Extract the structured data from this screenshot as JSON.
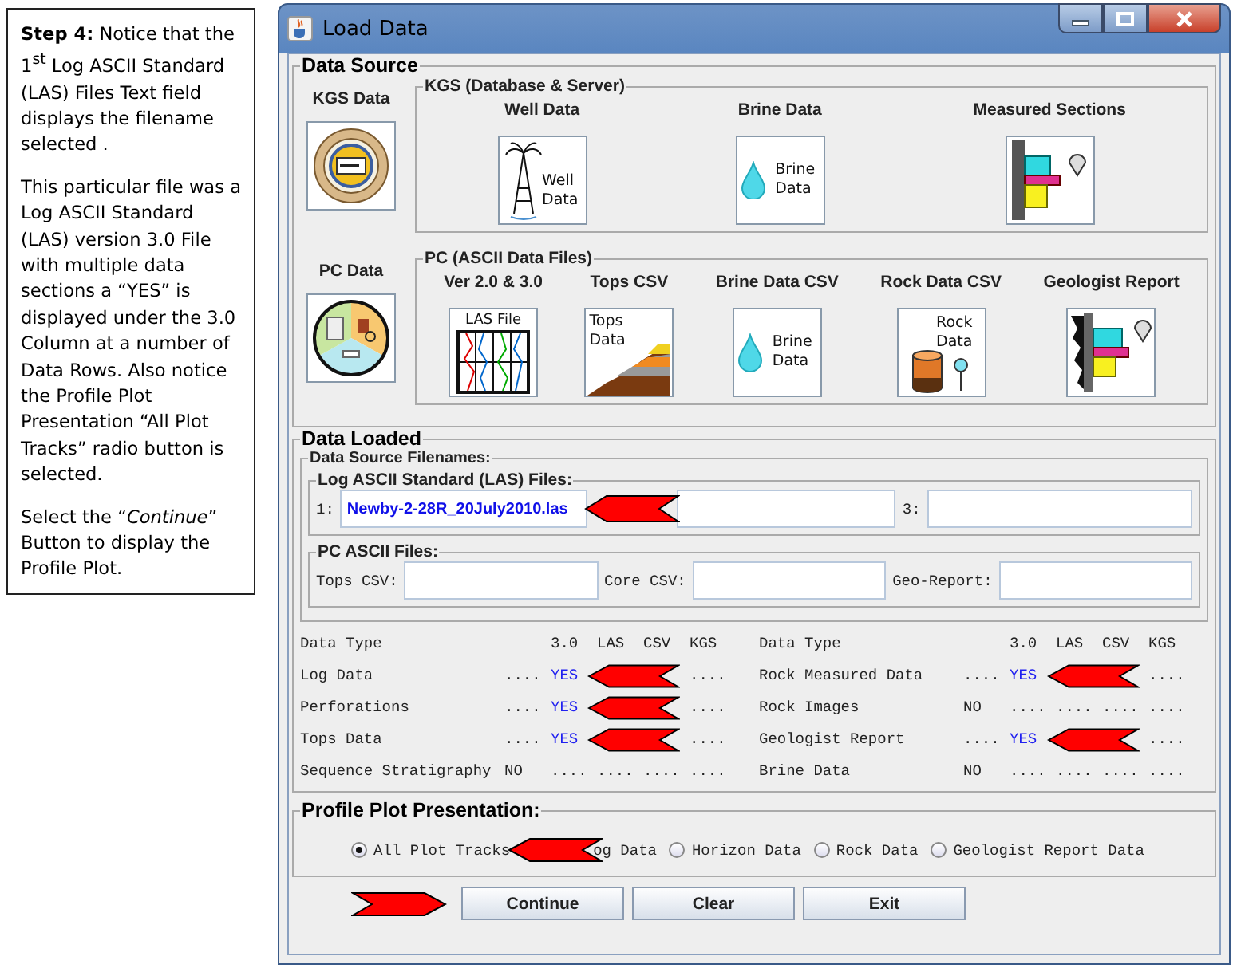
{
  "instructions": {
    "paragraphs": [
      "**Step 4:** Notice that the 1$^{st}$ Log ASCII Standard (LAS) Files Text field displays the filename selected .",
      "This particular file was a Log ASCII Standard (LAS) version 3.0 File with multiple data sections a “YES”  is displayed under the 3.0 Column at a number of Data Rows. Also notice the Profile Plot  Presentation “All Plot Tracks” radio button is selected.",
      "Select the “*Continue*” Button to display the Profile Plot."
    ]
  },
  "window": {
    "title": "Load Data"
  },
  "data_source": {
    "title": "Data Source",
    "groups": [
      {
        "side": {
          "label": "KGS Data",
          "kind": "seal"
        },
        "title": "KGS (Database & Server)",
        "items": [
          {
            "label": "Well Data",
            "kind": "well",
            "icon_text": "Well Data"
          },
          {
            "label": "Brine Data",
            "kind": "brine",
            "icon_text": "Brine Data"
          },
          {
            "label": "Measured Sections",
            "kind": "sections"
          }
        ]
      },
      {
        "side": {
          "label": "PC Data",
          "kind": "pie"
        },
        "title": "PC (ASCII Data Files)",
        "items": [
          {
            "label": "Ver 2.0 & 3.0",
            "kind": "las",
            "icon_text": "LAS File"
          },
          {
            "label": "Tops CSV",
            "kind": "tops",
            "icon_text": "Tops Data"
          },
          {
            "label": "Brine Data CSV",
            "kind": "brine",
            "icon_text": "Brine Data"
          },
          {
            "label": "Rock Data CSV",
            "kind": "rock",
            "icon_text": "Rock Data"
          },
          {
            "label": "Geologist Report",
            "kind": "report"
          }
        ]
      }
    ]
  },
  "data_loaded": {
    "title": "Data Loaded",
    "filenames_title": "Data Source Filenames:",
    "las": {
      "title": "Log ASCII Standard (LAS) Files:",
      "arrow": true,
      "fields": [
        {
          "kind": "text",
          "label": "1:",
          "value": "Newby-2-28R_20July2010.las"
        },
        {
          "kind": "text"
        },
        {
          "kind": "text",
          "label": "3:"
        }
      ]
    },
    "pc": {
      "title": "PC ASCII Files:",
      "fields": [
        {
          "label": "Tops CSV:"
        },
        {
          "label": "Core CSV:"
        },
        {
          "label": "Geo-Report:"
        }
      ]
    },
    "halves": [
      {
        "columns": [
          "Data Type",
          "3.0",
          "LAS",
          "CSV",
          "KGS"
        ],
        "rows": [
          {
            "label": "Log Data",
            "arrow": true,
            "loaded": true,
            "cells": [
              "....",
              "YES",
              "...."
            ]
          },
          {
            "label": "Perforations",
            "arrow": true,
            "loaded": true,
            "cells": [
              "....",
              "YES",
              "...."
            ]
          },
          {
            "label": "Tops Data",
            "arrow": true,
            "loaded": true,
            "cells": [
              "....",
              "YES",
              "...."
            ]
          },
          {
            "label": "Sequence Stratigraphy",
            "arrow": false,
            "loaded": false,
            "cells": [
              "NO",
              "....",
              "....",
              "....",
              "...."
            ]
          }
        ]
      },
      {
        "columns": [
          "Data Type",
          "3.0",
          "LAS",
          "CSV",
          "KGS"
        ],
        "rows": [
          {
            "label": "Rock Measured Data",
            "arrow": true,
            "loaded": true,
            "cells": [
              "....",
              "YES",
              "...."
            ]
          },
          {
            "label": "Rock Images",
            "arrow": false,
            "loaded": false,
            "cells": [
              "NO",
              "....",
              "....",
              "....",
              "...."
            ]
          },
          {
            "label": "Geologist Report",
            "arrow": true,
            "loaded": true,
            "cells": [
              "....",
              "YES",
              "...."
            ]
          },
          {
            "label": "Brine Data",
            "arrow": false,
            "loaded": false,
            "cells": [
              "NO",
              "....",
              "....",
              "....",
              "...."
            ]
          }
        ]
      }
    ]
  },
  "profile": {
    "title": "Profile Plot Presentation:",
    "options": [
      {
        "label": "All Plot Tracks",
        "selected": true,
        "arrow": true
      },
      {
        "label": "og Data",
        "arrow": false
      },
      {
        "label": "Horizon Data",
        "selected": false,
        "arrow": false
      },
      {
        "label": "Rock Data",
        "selected": false,
        "arrow": false
      },
      {
        "label": "Geologist Report Data",
        "selected": false,
        "arrow": false
      }
    ]
  },
  "buttons": [
    {
      "label": "Continue",
      "arrow": true
    },
    {
      "label": "Clear",
      "arrow": false
    },
    {
      "label": "Exit",
      "arrow": false
    }
  ]
}
